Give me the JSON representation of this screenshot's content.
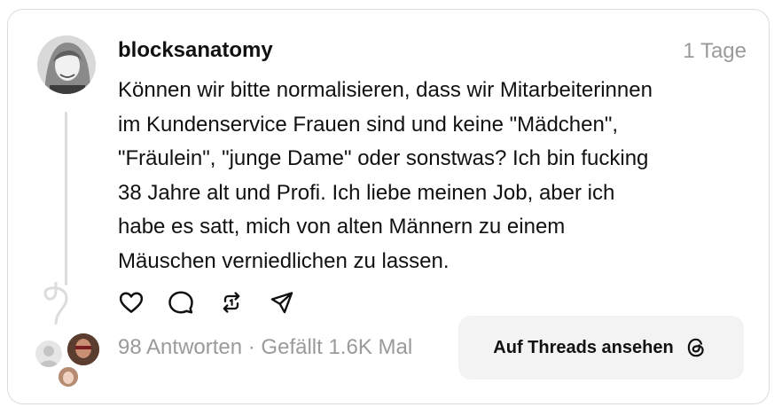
{
  "post": {
    "username": "blocksanatomy",
    "timestamp": "1 Tage",
    "text_lines": [
      "Können wir bitte normalisieren,  dass wir Mitarbeiterinnen",
      "im Kundenservice Frauen sind und keine \"Mädchen\",",
      "\"Fräulein\", \"junge Dame\" oder sonstwas? Ich bin fucking",
      "38 Jahre alt und Profi. Ich liebe meinen Job,  aber ich",
      "habe es satt, mich von alten Männern zu einem",
      "Mäuschen verniedlichen zu lassen."
    ]
  },
  "actions": [
    {
      "icon": "heart-icon"
    },
    {
      "icon": "comment-icon"
    },
    {
      "icon": "repost-icon"
    },
    {
      "icon": "share-icon"
    }
  ],
  "stats": {
    "text": "98 Antworten · Gefällt 1.6K Mal"
  },
  "cta": {
    "label": "Auf Threads ansehen",
    "icon": "threads-logo-icon"
  },
  "colors": {
    "text": "#111111",
    "muted": "#9a9a9a",
    "border": "#dcdcdc",
    "button_bg": "#f3f3f3"
  }
}
